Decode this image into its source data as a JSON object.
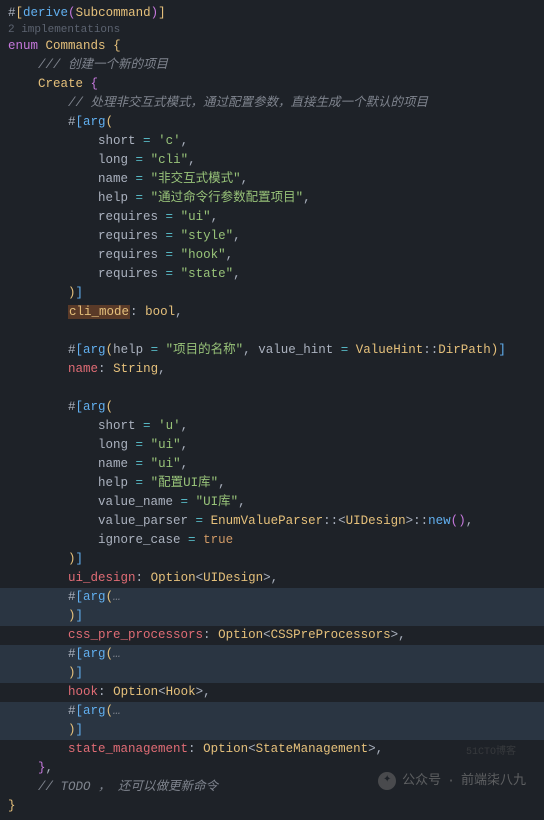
{
  "hint": "2 implementations",
  "code": {
    "derive": {
      "attr": "derive",
      "trait": "Subcommand"
    },
    "enum_kw": "enum",
    "enum_name": "Commands",
    "doc_create": "/// 创建一个新的项目",
    "variant": "Create",
    "comment_cli": "// 处理非交互式模式，通过配置参数，直接生成一个默认的项目",
    "arg_kw": "arg",
    "cli": {
      "short": "'c'",
      "long": "\"cli\"",
      "name": "\"非交互式模式\"",
      "help": "\"通过命令行参数配置项目\"",
      "req1": "\"ui\"",
      "req2": "\"style\"",
      "req3": "\"hook\"",
      "req4": "\"state\""
    },
    "cli_mode_field": "cli_mode",
    "bool_t": "bool",
    "name_arg_help": "\"项目的名称\"",
    "value_hint_kw": "value_hint",
    "value_hint_ty": "ValueHint",
    "dir_path": "DirPath",
    "name_field": "name",
    "string_t": "String",
    "ui": {
      "short": "'u'",
      "long": "\"ui\"",
      "name": "\"ui\"",
      "help": "\"配置UI库\"",
      "value_name": "\"UI库\"",
      "parser_ty": "EnumValueParser",
      "uidesign": "UIDesign",
      "ignore_case": "true"
    },
    "ui_design_field": "ui_design",
    "option_t": "Option",
    "css_field": "css_pre_processors",
    "css_ty": "CSSPreProcessors",
    "hook_field": "hook",
    "hook_ty": "Hook",
    "state_field": "state_management",
    "state_ty": "StateManagement",
    "todo": "// TODO ， 还可以做更新命令",
    "fold": "…"
  },
  "labels": {
    "short": "short",
    "long": "long",
    "name": "name",
    "help": "help",
    "requires": "requires",
    "value_name": "value_name",
    "value_parser": "value_parser",
    "ignore_case": "ignore_case",
    "new": "new"
  },
  "watermark": {
    "label": "公众号",
    "name": "前端柒八九"
  },
  "blog_mark": "51CTO博客"
}
